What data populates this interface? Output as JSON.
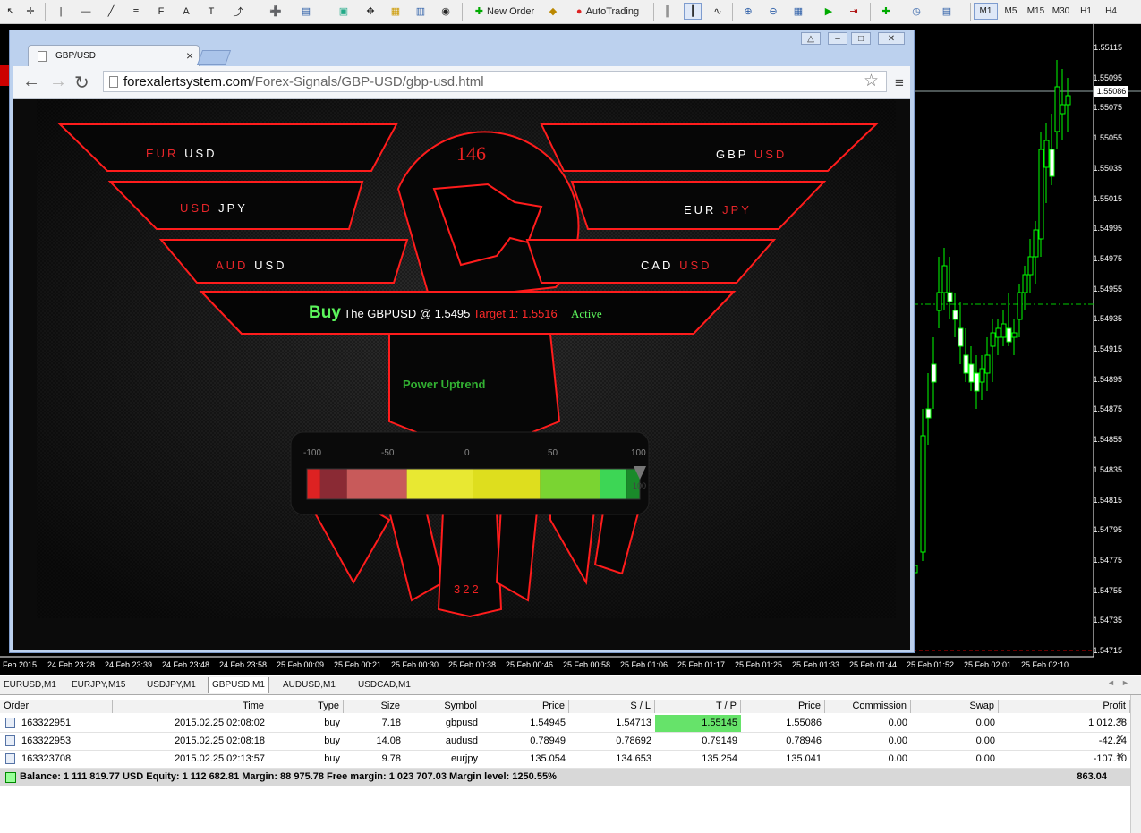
{
  "toolbar": {
    "new_order_label": "New Order",
    "autotrading_label": "AutoTrading",
    "timeframes": [
      {
        "label": "M1",
        "active": true
      },
      {
        "label": "M5",
        "active": false
      },
      {
        "label": "M15",
        "active": false
      },
      {
        "label": "M30",
        "active": false
      },
      {
        "label": "H1",
        "active": false
      },
      {
        "label": "H4",
        "active": false
      }
    ]
  },
  "chart": {
    "price_ticks": [
      "1.55115",
      "1.55095",
      "1.55075",
      "1.55055",
      "1.55035",
      "1.55015",
      "1.54995",
      "1.54975",
      "1.54955",
      "1.54935",
      "1.54915",
      "1.54895",
      "1.54875",
      "1.54855",
      "1.54835",
      "1.54815",
      "1.54795",
      "1.54775",
      "1.54755",
      "1.54735",
      "1.54715"
    ],
    "current_price": "1.55086",
    "time_ticks": [
      "Feb 2015",
      "24 Feb 23:28",
      "24 Feb 23:39",
      "24 Feb 23:48",
      "24 Feb 23:58",
      "25 Feb 00:09",
      "25 Feb 00:21",
      "25 Feb 00:30",
      "25 Feb 00:38",
      "25 Feb 00:46",
      "25 Feb 00:58",
      "25 Feb 01:06",
      "25 Feb 01:17",
      "25 Feb 01:25",
      "25 Feb 01:33",
      "25 Feb 01:44",
      "25 Feb 01:52",
      "25 Feb 02:01",
      "25 Feb 02:10"
    ],
    "bull_color": "#00ff00",
    "line_color": "#00aa00"
  },
  "browser": {
    "tab_title": "GBP/USD",
    "url_host": "forexalertsystem.com",
    "url_path": "/Forex-Signals/GBP-USD/gbp-usd.html"
  },
  "page": {
    "pairs_left": [
      {
        "a": "EUR",
        "b": "USD"
      },
      {
        "a": "USD",
        "b": "JPY"
      },
      {
        "a": "AUD",
        "b": "USD"
      }
    ],
    "pairs_right": [
      {
        "a": "GBP",
        "b": "USD"
      },
      {
        "a": "EUR",
        "b": "JPY"
      },
      {
        "a": "CAD",
        "b": "USD"
      }
    ],
    "counter_top": "146",
    "counter_bottom": "322",
    "signal": {
      "direction": "Buy",
      "text": "The GBPUSD @ 1.5495",
      "target": "Target 1: 1.5516",
      "status": "Active"
    },
    "trend": "Power Uptrend",
    "gauge": {
      "ticks": [
        "-100",
        "-50",
        "0",
        "50",
        "100"
      ],
      "value": 100,
      "value_label": "100"
    }
  },
  "chart_tabs": [
    {
      "label": "EURUSD,M1",
      "active": false
    },
    {
      "label": "EURJPY,M15",
      "active": false
    },
    {
      "label": "USDJPY,M1",
      "active": false
    },
    {
      "label": "GBPUSD,M1",
      "active": true
    },
    {
      "label": "AUDUSD,M1",
      "active": false
    },
    {
      "label": "USDCAD,M1",
      "active": false
    }
  ],
  "orders": {
    "headers": [
      "Order",
      "Time",
      "Type",
      "Size",
      "Symbol",
      "Price",
      "S / L",
      "T / P",
      "Price",
      "Commission",
      "Swap",
      "Profit"
    ],
    "rows": [
      [
        "163322951",
        "2015.02.25 02:08:02",
        "buy",
        "7.18",
        "gbpusd",
        "1.54945",
        "1.54713",
        "1.55145",
        "1.55086",
        "0.00",
        "0.00",
        "1 012.38"
      ],
      [
        "163322953",
        "2015.02.25 02:08:18",
        "buy",
        "14.08",
        "audusd",
        "0.78949",
        "0.78692",
        "0.79149",
        "0.78946",
        "0.00",
        "0.00",
        "-42.24"
      ],
      [
        "163323708",
        "2015.02.25 02:13:57",
        "buy",
        "9.78",
        "eurjpy",
        "135.054",
        "134.653",
        "135.254",
        "135.041",
        "0.00",
        "0.00",
        "-107.10"
      ]
    ],
    "balance_line": "Balance: 1 111 819.77 USD  Equity: 1 112 682.81  Margin: 88 975.78  Free margin: 1 023 707.03  Margin level: 1250.55%",
    "total_profit": "863.04"
  }
}
